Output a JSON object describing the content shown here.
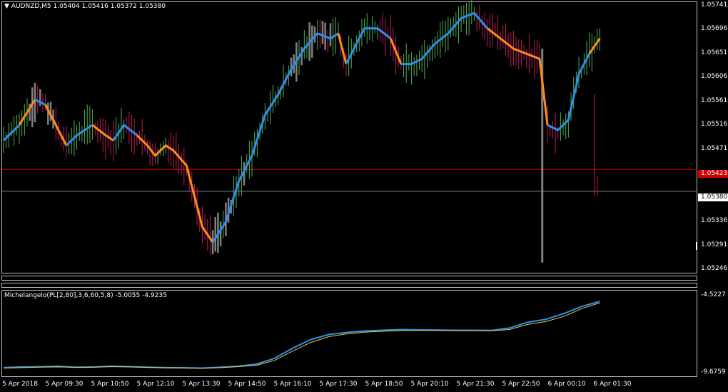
{
  "header": {
    "symbol_label": "AUDNZD,M5",
    "ohlc": "1.05404 1.05416 1.05372 1.05380"
  },
  "indicator": {
    "label": "Michelangelo(PL[2,80],3,6,60,5,8) -5.0055 -4.9235",
    "levels": [
      "-4.5227",
      "-9.6759"
    ]
  },
  "price_axis": {
    "labels": [
      "1.05741",
      "1.05696",
      "1.05651",
      "1.05606",
      "1.05561",
      "1.05516",
      "1.05471",
      "1.05336",
      "1.05291",
      "1.05246"
    ],
    "current_bid": "1.05380",
    "red_level": "1.05423"
  },
  "time_axis": {
    "labels": [
      "5 Apr 2018",
      "5 Apr 09:30",
      "5 Apr 10:50",
      "5 Apr 12:10",
      "5 Apr 13:30",
      "5 Apr 14:50",
      "5 Apr 16:10",
      "5 Apr 17:30",
      "5 Apr 18:50",
      "5 Apr 20:10",
      "5 Apr 21:30",
      "5 Apr 22:50",
      "6 Apr 00:10",
      "6 Apr 01:30"
    ]
  },
  "colors": {
    "background": "#000000",
    "bull_bar": "#4caf50",
    "bear_bar": "#c2185b",
    "neutral_bar": "#808080",
    "trend_up": "#2e8fe6",
    "trend_down": "#ff8c1a",
    "red_line": "#cc0000",
    "grey_line": "#808080",
    "signal_line": "#e8c85a"
  },
  "chart_data": {
    "type": "line",
    "title": "AUDNZD,M5",
    "ylim": [
      1.0522,
      1.0575
    ],
    "smoothed_line": {
      "x_index": [
        0,
        6,
        12,
        16,
        21,
        24,
        28,
        34,
        39,
        42,
        46,
        51,
        55,
        58,
        62,
        65,
        70,
        73,
        76,
        80,
        85,
        90,
        95,
        100,
        105,
        110,
        115,
        120,
        125,
        128,
        131,
        134,
        138,
        143,
        148,
        152,
        156,
        160,
        165,
        170,
        175,
        180,
        185,
        190,
        195,
        200,
        205,
        208,
        212,
        216,
        220,
        224,
        228
      ],
      "y": [
        1.0548,
        1.0551,
        1.0556,
        1.0555,
        1.055,
        1.0547,
        1.0549,
        1.0551,
        1.0549,
        1.0548,
        1.0551,
        1.0549,
        1.0547,
        1.0545,
        1.0547,
        1.0546,
        1.0543,
        1.0537,
        1.0531,
        1.0528,
        1.0532,
        1.054,
        1.0545,
        1.0553,
        1.0557,
        1.0562,
        1.0566,
        1.0569,
        1.0568,
        1.0569,
        1.0563,
        1.0566,
        1.057,
        1.057,
        1.0568,
        1.0563,
        1.0563,
        1.0564,
        1.0567,
        1.0569,
        1.0572,
        1.0573,
        1.057,
        1.0568,
        1.0566,
        1.0565,
        1.0564,
        1.0551,
        1.055,
        1.0552,
        1.0561,
        1.0565,
        1.0568
      ],
      "down_segments": [
        [
          6,
          12
        ],
        [
          16,
          24
        ],
        [
          34,
          42
        ],
        [
          51,
          80
        ],
        [
          128,
          131
        ],
        [
          148,
          152
        ],
        [
          185,
          208
        ],
        [
          224,
          228
        ]
      ]
    },
    "indicator_series": [
      {
        "values": [
          -9.55,
          -9.5,
          -9.48,
          -9.45,
          -9.52,
          -9.5,
          -9.45,
          -9.48,
          -9.52,
          -9.55,
          -9.56,
          -9.58,
          -9.52,
          -9.45,
          -9.3,
          -8.9,
          -8.2,
          -7.6,
          -7.25,
          -7.1,
          -7.0,
          -6.95,
          -6.9,
          -6.92,
          -6.93,
          -6.95,
          -6.95,
          -6.96,
          -6.8,
          -6.4,
          -6.2,
          -5.8,
          -5.3,
          -4.95
        ]
      },
      {
        "values": [
          -9.58,
          -9.55,
          -9.52,
          -9.5,
          -9.53,
          -9.52,
          -9.48,
          -9.5,
          -9.53,
          -9.56,
          -9.57,
          -9.59,
          -9.55,
          -9.48,
          -9.38,
          -9.05,
          -8.4,
          -7.8,
          -7.4,
          -7.2,
          -7.08,
          -7.02,
          -6.97,
          -6.97,
          -6.97,
          -6.98,
          -6.98,
          -6.99,
          -6.9,
          -6.55,
          -6.35,
          -6.0,
          -5.45,
          -5.05
        ]
      }
    ],
    "indicator_ylim": [
      -9.9,
      -4.35
    ]
  }
}
